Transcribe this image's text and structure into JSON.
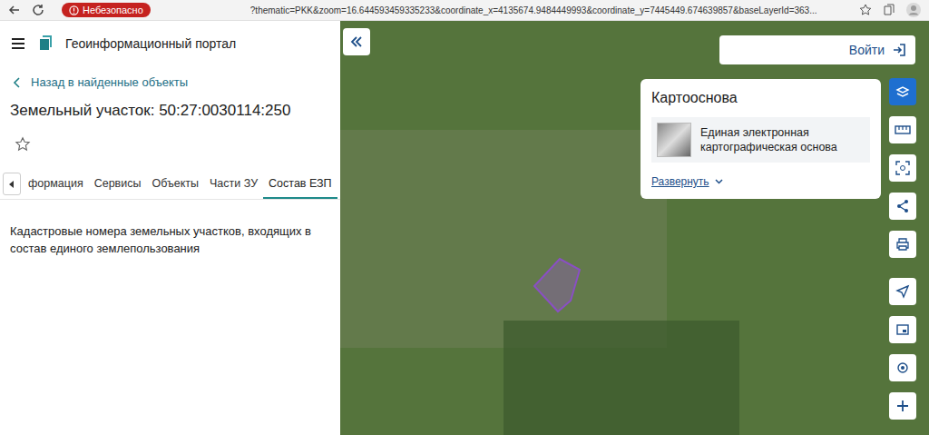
{
  "browser": {
    "security_badge": "Небезопасно",
    "url": "?thematic=PKK&zoom=16.644593459335233&coordinate_x=4135674.9484449993&coordinate_y=7445449.674639857&baseLayerId=363..."
  },
  "portal": {
    "title": "Геоинформационный портал"
  },
  "back_link": "Назад в найденные объекты",
  "object_title": "Земельный участок: 50:27:0030114:250",
  "favorite": false,
  "tabs": [
    {
      "label": "формация",
      "selected": false
    },
    {
      "label": "Сервисы",
      "selected": false
    },
    {
      "label": "Объекты",
      "selected": false
    },
    {
      "label": "Части ЗУ",
      "selected": false
    },
    {
      "label": "Состав ЕЗП",
      "selected": true
    }
  ],
  "section_text": "Кадастровые номера земельных участков, входящих в состав единого землепользования",
  "map": {
    "login_button": "Войти",
    "basemap_card": {
      "title": "Картооснова",
      "layer": "Единая электронная картографическая основа",
      "expand_link": "Развернуть"
    }
  }
}
